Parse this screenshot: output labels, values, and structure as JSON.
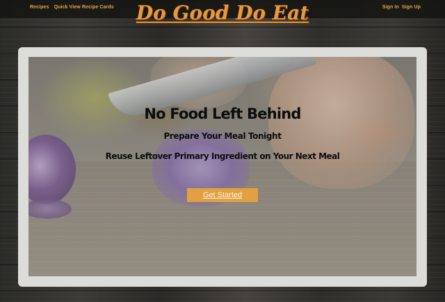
{
  "nav": {
    "left_links": [
      {
        "label": "Recipes"
      },
      {
        "label": "Quick View Recipe Cards"
      }
    ],
    "right_links": [
      {
        "label": "Sign In"
      },
      {
        "label": "Sign Up"
      }
    ]
  },
  "brand": {
    "name": "Do Good Do Eat"
  },
  "hero": {
    "title": "No Food Left Behind",
    "line1": "Prepare Your Meal Tonight",
    "line2": "Reuse Leftover Primary Ingredient on Your Next Meal",
    "cta_label": "Get Started"
  },
  "colors": {
    "accent": "#e3a040",
    "brand": "#e8993a",
    "nav_link": "#e2a93c"
  }
}
